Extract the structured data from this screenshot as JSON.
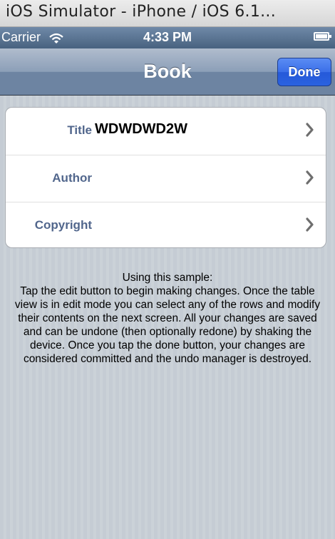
{
  "window": {
    "title": "iOS Simulator - iPhone / iOS 6.1..."
  },
  "status_bar": {
    "carrier": "Carrier",
    "time": "4:33 PM"
  },
  "nav_bar": {
    "title": "Book",
    "done_label": "Done"
  },
  "rows": [
    {
      "label": "Title",
      "value": "WDWDWD2W"
    },
    {
      "label": "Author",
      "value": ""
    },
    {
      "label": "Copyright",
      "value": ""
    }
  ],
  "info": {
    "heading": "Using this sample:",
    "lines": [
      "Tap the edit button to begin making changes.  Once the table",
      "view is in edit mode you can select any of the rows and modify",
      "their contents on the next screen.  All your changes are saved",
      "and can be undone (then optionally redone) by shaking the",
      "device.  Once you tap the done button, your changes are",
      "considered committed and the undo manager is destroyed."
    ]
  },
  "icons": {
    "wifi": "wifi-icon",
    "battery": "battery-icon",
    "chevron": "chevron-right-icon"
  },
  "colors": {
    "nav_tint": "#6d84a2",
    "done_button": "#2a62e0",
    "label_blue": "#51668c"
  }
}
